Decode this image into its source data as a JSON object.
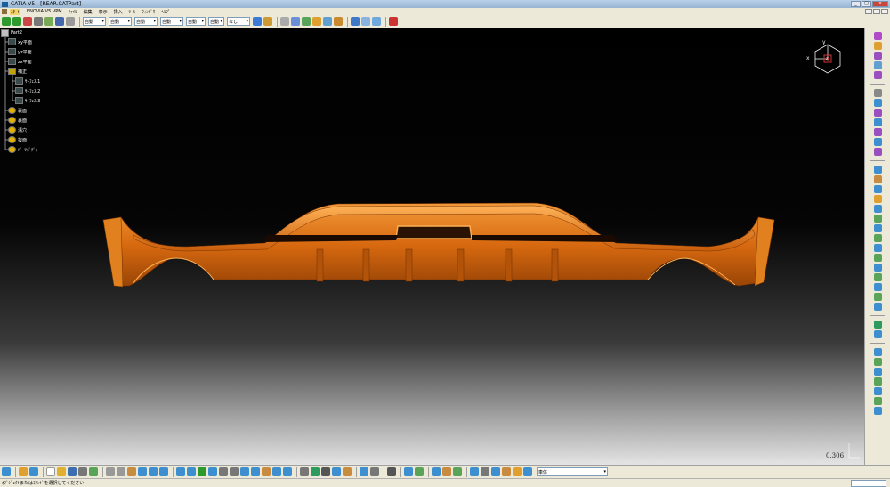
{
  "window": {
    "title": "CATIA V5 - [REAR.CATPart]",
    "minimize": "_",
    "maximize": "□",
    "close": "×"
  },
  "menubar": {
    "items": [
      {
        "label": "ｽﾀｰﾄ",
        "active": true
      },
      {
        "label": "ENOVIA V5 VPM",
        "active": false
      },
      {
        "label": "ﾌｧｲﾙ",
        "active": false
      },
      {
        "label": "編集",
        "active": false
      },
      {
        "label": "表示",
        "active": false
      },
      {
        "label": "挿入",
        "active": false
      },
      {
        "label": "ﾂｰﾙ",
        "active": false
      },
      {
        "label": "ｳｨﾝﾄﾞｳ",
        "active": false
      },
      {
        "label": "ﾍﾙﾌﾟ",
        "active": false
      }
    ]
  },
  "toolbar_top": {
    "combos": [
      "自動",
      "自動",
      "自動",
      "自動",
      "自動",
      "自動",
      "なし"
    ]
  },
  "tree": {
    "nodes": [
      {
        "label": "Part2",
        "icon": "root"
      },
      {
        "label": "xy平面",
        "icon": "plane"
      },
      {
        "label": "yz平面",
        "icon": "plane"
      },
      {
        "label": "zx平面",
        "icon": "plane"
      },
      {
        "label": "補正",
        "icon": "set"
      },
      {
        "label": "ｻｰﾌｪｽ.1",
        "icon": "plane"
      },
      {
        "label": "ｻｰﾌｪｽ.2",
        "icon": "plane"
      },
      {
        "label": "ｻｰﾌｪｽ.3",
        "icon": "plane"
      },
      {
        "label": "裏面",
        "icon": "gear"
      },
      {
        "label": "裏面",
        "icon": "gear"
      },
      {
        "label": "溝穴",
        "icon": "gear"
      },
      {
        "label": "抜面",
        "icon": "gear"
      },
      {
        "label": "ﾊﾟｰﾂﾎﾞﾃﾞｨｰ",
        "icon": "gear"
      }
    ]
  },
  "compass": {
    "x": "x",
    "y": "y",
    "z": "z"
  },
  "viewport": {
    "scale": "0.306"
  },
  "toolbar_bottom": {
    "combo": "車体"
  },
  "status": {
    "message": "ｵﾌﾞｼﾞｪｸﾄまたはｺﾏﾝﾄﾞを選択してください"
  },
  "colors": {
    "part": "#d86a10",
    "part_highlight": "#f29a3a",
    "part_shadow": "#8e3d04",
    "background_top": "#000000",
    "background_bottom": "#e4e4e4"
  }
}
